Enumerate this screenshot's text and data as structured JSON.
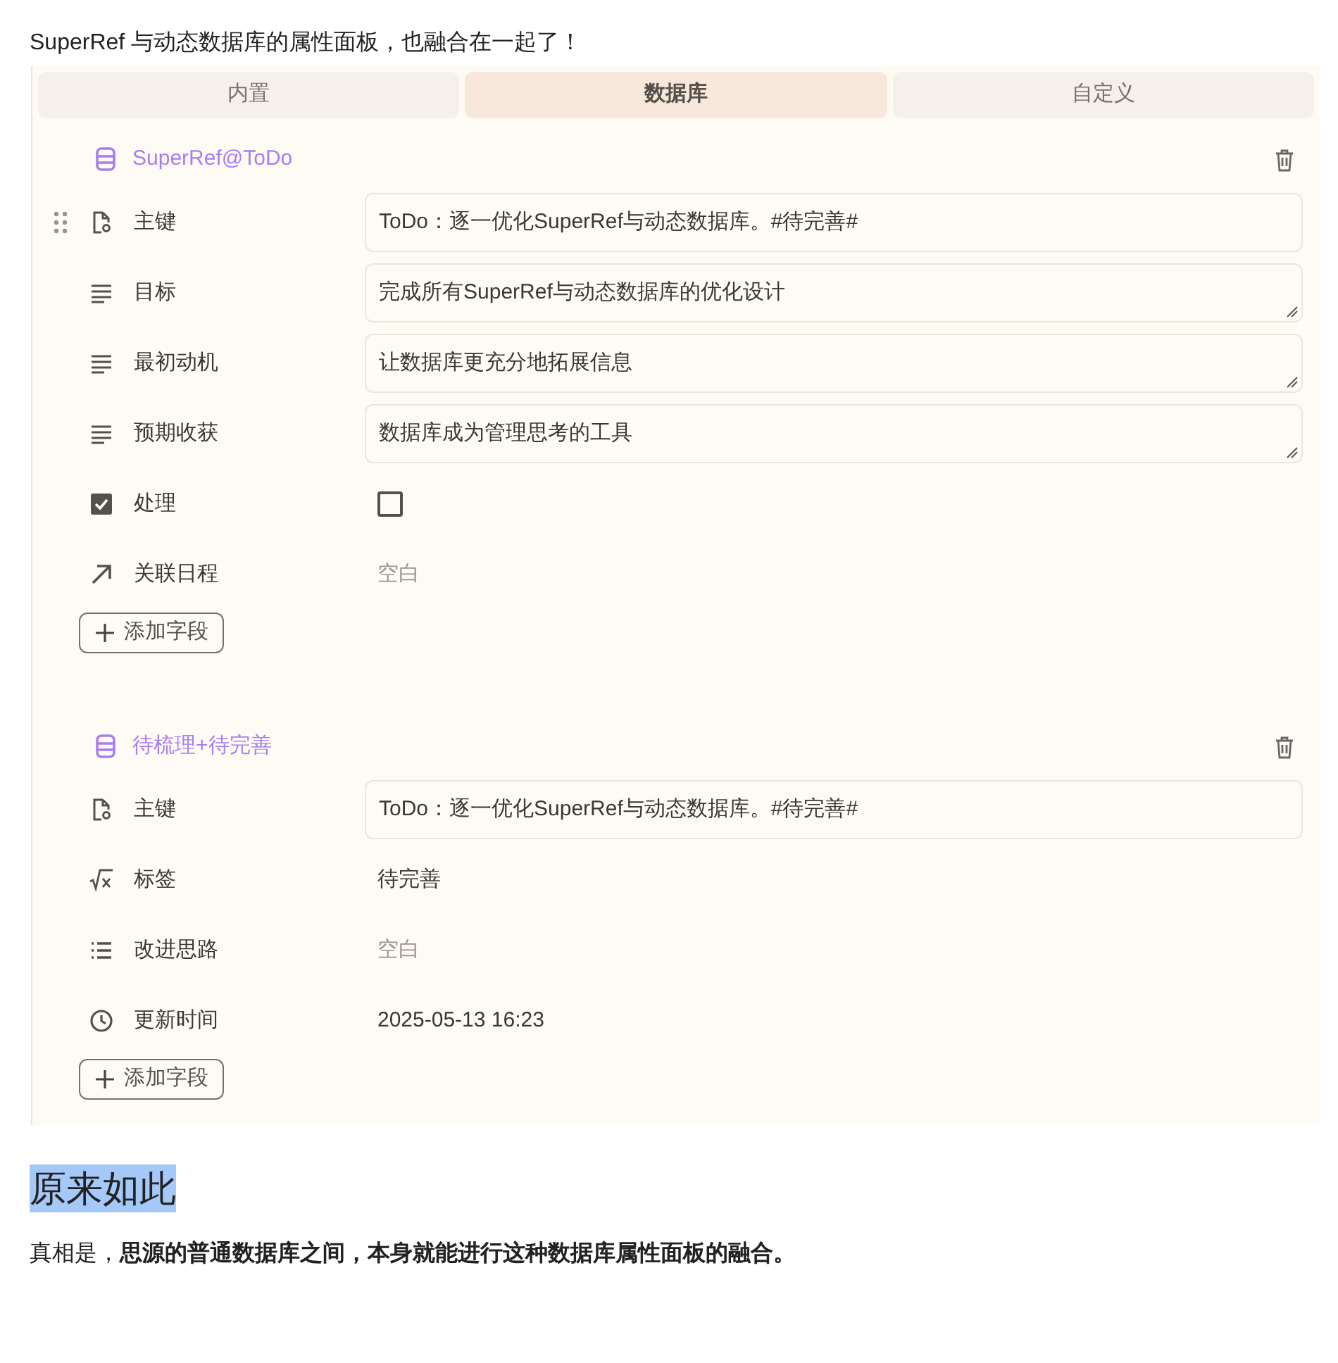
{
  "intro": "SuperRef 与动态数据库的属性面板，也融合在一起了！",
  "tabs": [
    {
      "label": "内置",
      "selected": false
    },
    {
      "label": "数据库",
      "selected": true
    },
    {
      "label": "自定义",
      "selected": false
    }
  ],
  "sections": [
    {
      "title": "SuperRef@ToDo",
      "add_label": "添加字段",
      "fields": [
        {
          "kind": "key",
          "label": "主键",
          "value": "ToDo：逐一优化SuperRef与动态数据库。#待完善#",
          "drag_handle": true
        },
        {
          "kind": "lines",
          "label": "目标",
          "value": "完成所有SuperRef与动态数据库的优化设计",
          "drag_handle": false
        },
        {
          "kind": "lines",
          "label": "最初动机",
          "value": "让数据库更充分地拓展信息",
          "drag_handle": false
        },
        {
          "kind": "lines",
          "label": "预期收获",
          "value": "数据库成为管理思考的工具",
          "drag_handle": false
        },
        {
          "kind": "check",
          "label": "处理",
          "checked": false,
          "drag_handle": false
        },
        {
          "kind": "arrow",
          "label": "关联日程",
          "value": "空白",
          "drag_handle": false
        }
      ]
    },
    {
      "title": "待梳理+待完善",
      "add_label": "添加字段",
      "fields": [
        {
          "kind": "key",
          "label": "主键",
          "value": "ToDo：逐一优化SuperRef与动态数据库。#待完善#",
          "drag_handle": false
        },
        {
          "kind": "sqrt",
          "label": "标签",
          "value": "待完善",
          "drag_handle": false
        },
        {
          "kind": "list",
          "label": "改进思路",
          "value": "空白",
          "drag_handle": false
        },
        {
          "kind": "clock",
          "label": "更新时间",
          "value": "2025-05-13 16:23",
          "drag_handle": false
        }
      ]
    }
  ],
  "heading": "原来如此",
  "conclusion": "真相是，**思源的普通数据库之间，本身就能进行这种数据库属性面板的融合。**"
}
